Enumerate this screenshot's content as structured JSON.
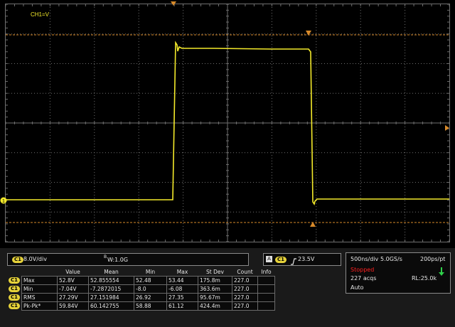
{
  "channel_label": "CH1=V",
  "channel_marker": "1",
  "trigger_marker_label": "A",
  "vertical": {
    "channel_badge": "C1",
    "scale": "8.0V/div",
    "bandwidth_prefix": "B",
    "bandwidth_value": "W:1.0G"
  },
  "trigger": {
    "source_badge": "C1",
    "mode_badge": "A",
    "level": "23.5V"
  },
  "timebase": {
    "horizontal_scale": "500ns/div",
    "sample_rate": "5.0GS/s",
    "point_interval": "200ps/pt",
    "run_state": "Stopped",
    "acquisitions": "227 acqs",
    "record_length": "RL:25.0k",
    "mode": "Auto"
  },
  "measurements": {
    "headers": [
      "",
      "",
      "Value",
      "Mean",
      "Min",
      "Max",
      "St Dev",
      "Count",
      "Info"
    ],
    "rows": [
      {
        "badge": "C1",
        "name": "Max",
        "value": "52.8V",
        "mean": "52.855554",
        "min": "52.48",
        "max": "53.44",
        "stdev": "175.8m",
        "count": "227.0",
        "info": ""
      },
      {
        "badge": "C1",
        "name": "Min",
        "value": "-7.04V",
        "mean": "-7.2872015",
        "min": "-8.0",
        "max": "-6.08",
        "stdev": "363.6m",
        "count": "227.0",
        "info": ""
      },
      {
        "badge": "C1",
        "name": "RMS",
        "value": "27.29V",
        "mean": "27.151984",
        "min": "26.92",
        "max": "27.35",
        "stdev": "95.67m",
        "count": "227.0",
        "info": ""
      },
      {
        "badge": "C1",
        "name": "Pk-Pk*",
        "value": "59.84V",
        "mean": "60.142755",
        "min": "58.88",
        "max": "61.12",
        "stdev": "424.4m",
        "count": "227.0",
        "info": ""
      }
    ]
  },
  "colors": {
    "trace": "#f4ea2a",
    "grid": "#6f6f6f",
    "cursor": "#d88a2a",
    "panel": "#1a1a1a",
    "stopped": "#ff2020",
    "acq_arrow": "#2fd14a"
  },
  "icons": {
    "trigger_position": "orange-triangle-down",
    "trigger_level": "orange-triangle-left",
    "acq_status": "green-down-arrow-icon",
    "edge": "rising-edge-icon"
  }
}
